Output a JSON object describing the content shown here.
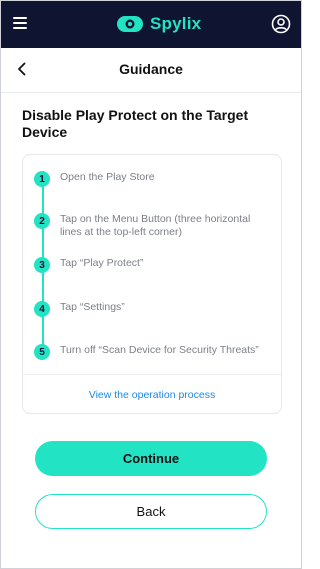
{
  "app": {
    "brand_name": "Spylix",
    "accent_color": "#22E3C4",
    "header_bg": "#0F1430",
    "icons": {
      "menu": "hamburger-icon",
      "profile": "user-circle-icon",
      "back": "chevron-left-icon",
      "logo": "spylix-logo-icon"
    }
  },
  "header": {
    "title": "Guidance"
  },
  "section": {
    "title": "Disable Play Protect on the Target Device"
  },
  "steps": [
    {
      "num": "1",
      "text": "Open the Play Store"
    },
    {
      "num": "2",
      "text": "Tap on the Menu Button (three horizontal lines at the top-left corner)"
    },
    {
      "num": "3",
      "text": "Tap “Play Protect”"
    },
    {
      "num": "4",
      "text": "Tap “Settings”"
    },
    {
      "num": "5",
      "text": "Turn off “Scan Device for Security Threats”"
    }
  ],
  "card": {
    "link_text": "View the operation process"
  },
  "buttons": {
    "continue": "Continue",
    "back": "Back"
  }
}
